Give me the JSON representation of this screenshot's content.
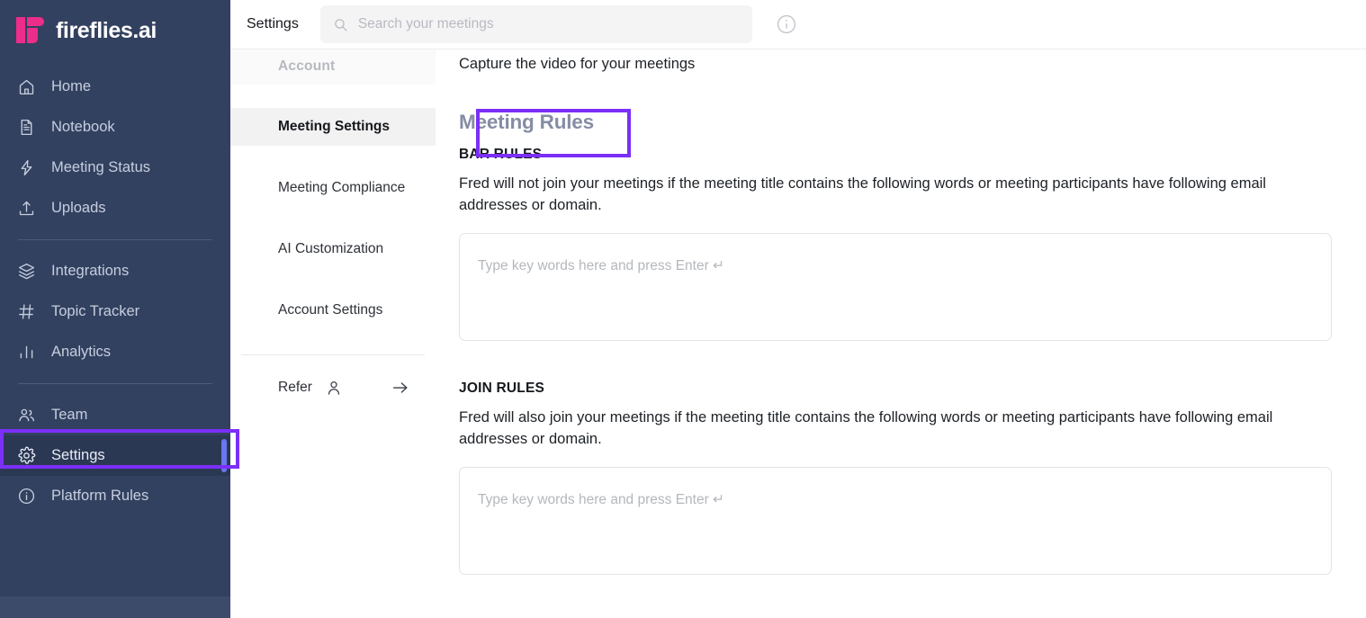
{
  "brand": {
    "name": "fireflies.ai",
    "logo_icon": "fireflies-logo-icon",
    "accent": "#ec2d8a"
  },
  "sidebar": {
    "bg": "#334160",
    "groups": [
      {
        "items": [
          {
            "label": "Home",
            "icon": "home-icon"
          },
          {
            "label": "Notebook",
            "icon": "notebook-icon"
          },
          {
            "label": "Meeting Status",
            "icon": "lightning-bolt-icon"
          },
          {
            "label": "Uploads",
            "icon": "upload-icon"
          }
        ]
      },
      {
        "items": [
          {
            "label": "Integrations",
            "icon": "layers-icon"
          },
          {
            "label": "Topic Tracker",
            "icon": "hash-icon"
          },
          {
            "label": "Analytics",
            "icon": "bar-chart-icon"
          }
        ]
      },
      {
        "items": [
          {
            "label": "Team",
            "icon": "people-icon"
          },
          {
            "label": "Settings",
            "icon": "gear-icon",
            "active": true
          },
          {
            "label": "Platform Rules",
            "icon": "info-circle-icon"
          }
        ]
      }
    ]
  },
  "subnav": {
    "header": "Account",
    "items": [
      {
        "label": "Meeting Settings",
        "selected": true
      },
      {
        "label": "Meeting Compliance",
        "selected": false
      },
      {
        "label": "AI Customization",
        "selected": false
      },
      {
        "label": "Account Settings",
        "selected": false
      }
    ],
    "refer": {
      "label": "Refer",
      "person_icon": "person-icon",
      "arrow_icon": "arrow-right-icon"
    }
  },
  "topbar": {
    "title": "Settings",
    "search_placeholder": "Search your meetings",
    "search_value": "",
    "search_icon": "search-icon",
    "info_icon": "info-circle-icon"
  },
  "content": {
    "capture_line": "Capture the video for your meetings",
    "section_title": "Meeting Rules",
    "bar_rules": {
      "label": "BAR RULES",
      "description": "Fred will not join your meetings if the meeting title contains the following words or meeting participants have following email addresses or domain.",
      "input_placeholder": "Type key words here and press Enter ↵",
      "input_value": ""
    },
    "join_rules": {
      "label": "JOIN RULES",
      "description": "Fred will also join your meetings if the meeting title contains the following words or meeting participants have following email addresses or domain.",
      "input_placeholder": "Type key words here and press Enter ↵",
      "input_value": ""
    }
  },
  "annotations": {
    "color": "#7b2ff7",
    "boxes": [
      {
        "name": "settings-sidebar-highlight",
        "target": "Settings"
      },
      {
        "name": "meeting-rules-heading-highlight",
        "target": "Meeting Rules"
      }
    ]
  }
}
